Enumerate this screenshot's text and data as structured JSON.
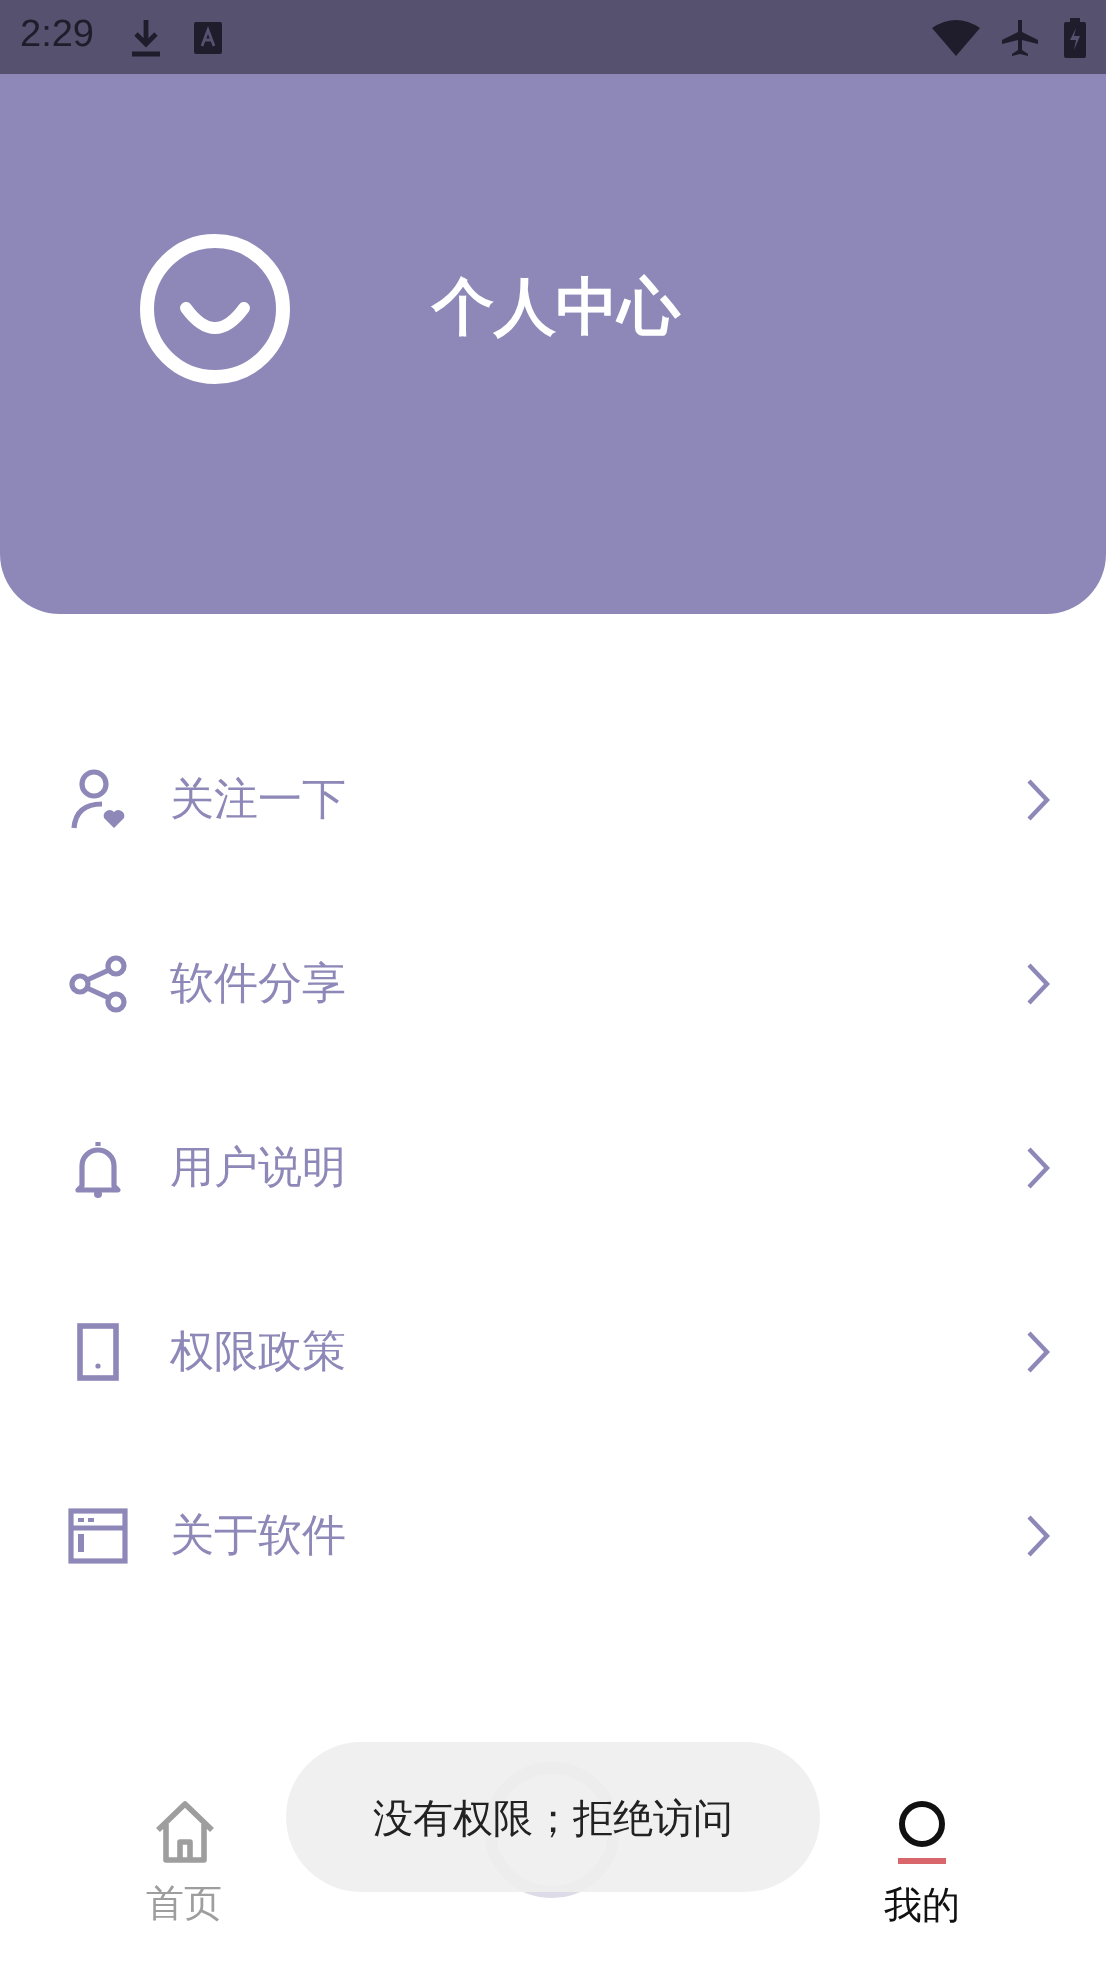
{
  "status_bar": {
    "time": "2:29"
  },
  "header": {
    "title": "个人中心"
  },
  "menu": [
    {
      "kind": "follow",
      "label": "关注一下"
    },
    {
      "kind": "share",
      "label": "软件分享"
    },
    {
      "kind": "notice",
      "label": "用户说明"
    },
    {
      "kind": "permission",
      "label": "权限政策"
    },
    {
      "kind": "about",
      "label": "关于软件"
    }
  ],
  "bottom_nav": [
    {
      "kind": "home",
      "label": "首页",
      "selected": false
    },
    {
      "kind": "center",
      "selected": false
    },
    {
      "kind": "me",
      "label": "我的",
      "selected": true
    }
  ],
  "toast": {
    "text": "没有权限；拒绝访问"
  }
}
